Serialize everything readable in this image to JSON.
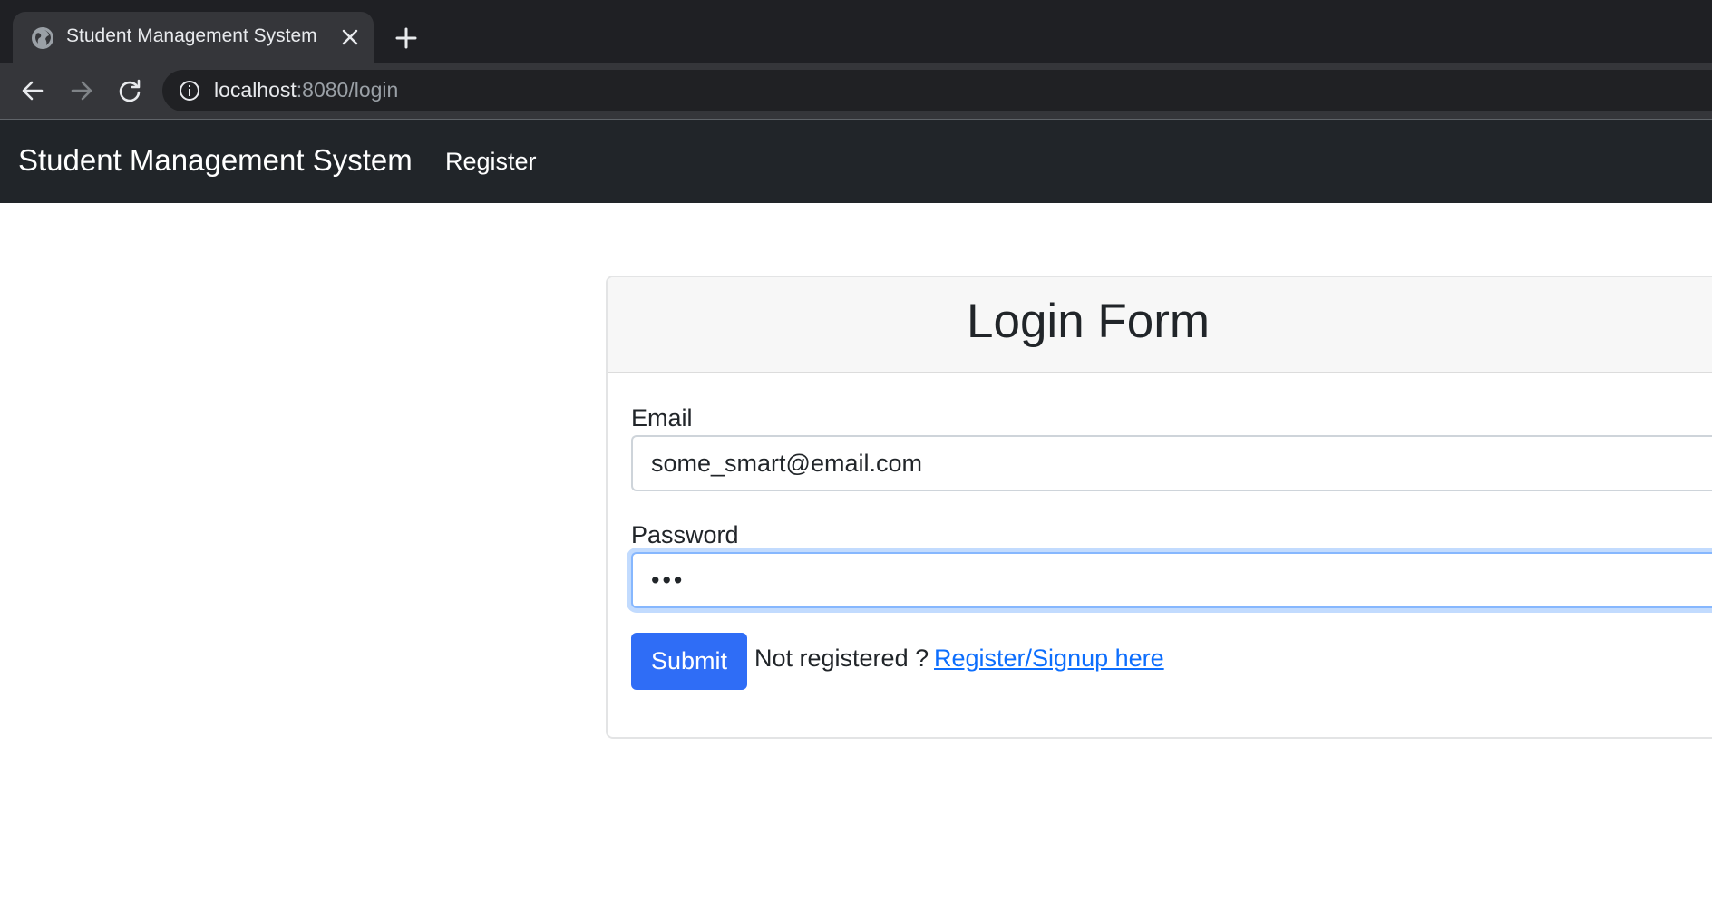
{
  "browser": {
    "tab": {
      "title": "Student Management System"
    },
    "address_bar": {
      "host": "localhost",
      "rest": ":8080/login"
    }
  },
  "navbar": {
    "brand": "Student Management System",
    "links": [
      {
        "label": "Register"
      }
    ]
  },
  "login_form": {
    "title": "Login Form",
    "email": {
      "label": "Email",
      "value": "some_smart@email.com"
    },
    "password": {
      "label": "Password",
      "value": "•••",
      "focused": true
    },
    "submit_label": "Submit",
    "not_registered_text": "Not registered ?",
    "signup_link_text": "Register/Signup here"
  },
  "colors": {
    "chrome_dark": "#1f2024",
    "navbar_bg": "#212529",
    "primary_button": "#2f6df6",
    "link": "#0d6efd",
    "focus_ring": "#86b7fe"
  },
  "icons": {
    "favicon": "globe-icon",
    "tab_close": "close-icon",
    "new_tab": "plus-icon",
    "back": "arrow-left-icon",
    "forward": "arrow-right-icon",
    "reload": "reload-icon",
    "site_info": "info-icon"
  }
}
